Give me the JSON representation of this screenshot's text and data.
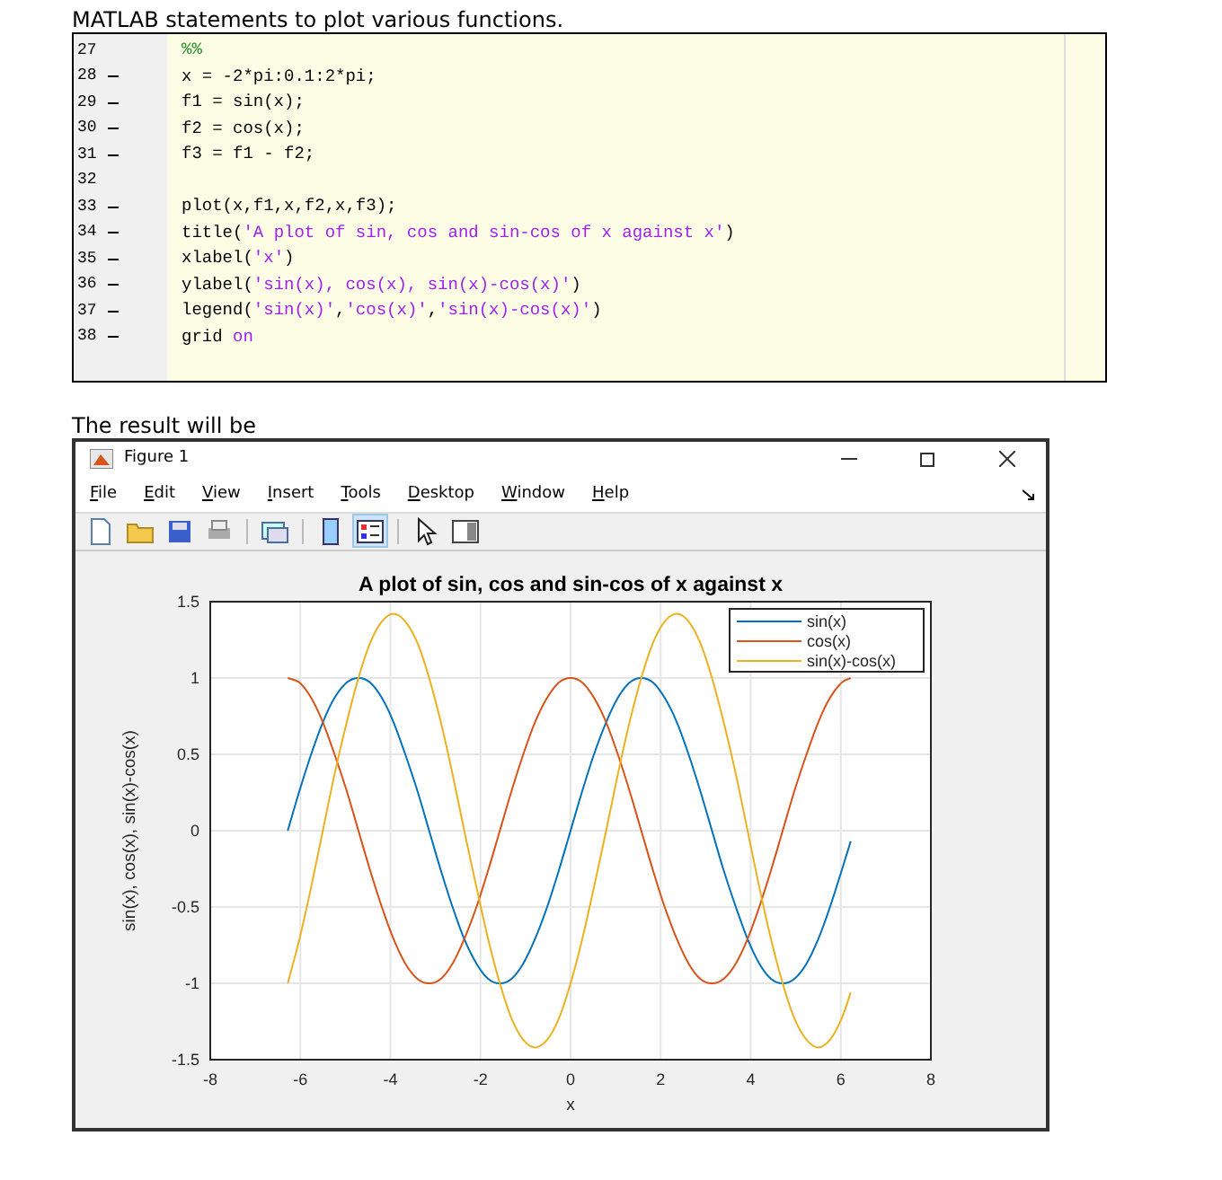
{
  "heading": "MATLAB statements to plot various functions.",
  "editor": {
    "lines": [
      {
        "number": "27",
        "executable": false,
        "tokens": [
          {
            "kind": "comment",
            "text": "%%"
          }
        ]
      },
      {
        "number": "28",
        "executable": true,
        "tokens": [
          {
            "kind": "plain",
            "text": "x = -2*pi:0.1:2*pi;"
          }
        ]
      },
      {
        "number": "29",
        "executable": true,
        "tokens": [
          {
            "kind": "plain",
            "text": "f1 = sin(x);"
          }
        ]
      },
      {
        "number": "30",
        "executable": true,
        "tokens": [
          {
            "kind": "plain",
            "text": "f2 = cos(x);"
          }
        ]
      },
      {
        "number": "31",
        "executable": true,
        "tokens": [
          {
            "kind": "plain",
            "text": "f3 = f1 - f2;"
          }
        ]
      },
      {
        "number": "32",
        "executable": false
      },
      {
        "number": "33",
        "executable": true,
        "tokens": [
          {
            "kind": "plain",
            "text": "plot(x,f1,x,f2,x,f3);"
          }
        ]
      },
      {
        "number": "34",
        "executable": true,
        "tokens": [
          {
            "kind": "plain",
            "text": "title("
          },
          {
            "kind": "string",
            "text": "'A plot of sin, cos and sin-cos of x against x'"
          },
          {
            "kind": "plain",
            "text": ")"
          }
        ]
      },
      {
        "number": "35",
        "executable": true,
        "tokens": [
          {
            "kind": "plain",
            "text": "xlabel("
          },
          {
            "kind": "string",
            "text": "'x'"
          },
          {
            "kind": "plain",
            "text": ")"
          }
        ]
      },
      {
        "number": "36",
        "executable": true,
        "tokens": [
          {
            "kind": "plain",
            "text": "ylabel("
          },
          {
            "kind": "string",
            "text": "'sin(x), cos(x), sin(x)-cos(x)'"
          },
          {
            "kind": "plain",
            "text": ")"
          }
        ]
      },
      {
        "number": "37",
        "executable": true,
        "tokens": [
          {
            "kind": "plain",
            "text": "legend("
          },
          {
            "kind": "string",
            "text": "'sin(x)'"
          },
          {
            "kind": "plain",
            "text": ","
          },
          {
            "kind": "string",
            "text": "'cos(x)'"
          },
          {
            "kind": "plain",
            "text": ","
          },
          {
            "kind": "string",
            "text": "'sin(x)-cos(x)'"
          },
          {
            "kind": "plain",
            "text": ")"
          }
        ]
      },
      {
        "number": "38",
        "executable": true,
        "tokens": [
          {
            "kind": "plain",
            "text": "grid "
          },
          {
            "kind": "string",
            "text": "on"
          }
        ]
      }
    ]
  },
  "intro": "The result will be",
  "figure": {
    "title": "Figure 1",
    "menus": [
      "File",
      "Edit",
      "View",
      "Insert",
      "Tools",
      "Desktop",
      "Window",
      "Help"
    ],
    "toolbar": [
      {
        "kind": "new",
        "selected": false
      },
      {
        "kind": "open",
        "selected": false
      },
      {
        "kind": "save",
        "selected": false
      },
      {
        "kind": "print",
        "selected": false
      },
      {
        "kind": "link",
        "selected": false
      },
      {
        "kind": "colorbar",
        "selected": false
      },
      {
        "kind": "legend",
        "selected": true
      },
      {
        "kind": "pointer",
        "selected": false
      },
      {
        "kind": "property",
        "selected": false
      }
    ],
    "chart_data": {
      "type": "line",
      "title": "A plot of sin, cos and sin-cos of x against x",
      "xlabel": "x",
      "ylabel": "sin(x), cos(x), sin(x)-cos(x)",
      "x": [
        -6.28,
        -6.02,
        -5.76,
        -5.5,
        -5.24,
        -4.97,
        -4.71,
        -4.45,
        -4.19,
        -3.93,
        -3.67,
        -3.4,
        -3.14,
        -2.88,
        -2.62,
        -2.36,
        -2.09,
        -1.83,
        -1.57,
        -1.31,
        -1.05,
        -0.79,
        -0.52,
        -0.26,
        0,
        0.26,
        0.52,
        0.79,
        1.05,
        1.31,
        1.57,
        1.83,
        2.09,
        2.36,
        2.62,
        2.88,
        3.14,
        3.4,
        3.67,
        3.93,
        4.19,
        4.45,
        4.71,
        4.97,
        5.24,
        5.5,
        5.76,
        6.02,
        6.22
      ],
      "series": [
        {
          "name": "sin(x)",
          "color": "#0072bd",
          "values": [
            0,
            0.26,
            0.5,
            0.71,
            0.87,
            0.97,
            1,
            0.97,
            0.87,
            0.71,
            0.5,
            0.26,
            0,
            -0.26,
            -0.5,
            -0.71,
            -0.87,
            -0.97,
            -1,
            -0.97,
            -0.87,
            -0.71,
            -0.5,
            -0.26,
            0,
            0.26,
            0.5,
            0.71,
            0.87,
            0.97,
            1,
            0.97,
            0.87,
            0.71,
            0.5,
            0.26,
            0,
            -0.26,
            -0.5,
            -0.71,
            -0.87,
            -0.97,
            -1,
            -0.97,
            -0.87,
            -0.71,
            -0.5,
            -0.26,
            -0.07
          ]
        },
        {
          "name": "cos(x)",
          "color": "#d95319",
          "values": [
            1,
            0.97,
            0.87,
            0.71,
            0.5,
            0.26,
            0,
            -0.26,
            -0.5,
            -0.71,
            -0.87,
            -0.97,
            -1,
            -0.97,
            -0.87,
            -0.71,
            -0.5,
            -0.26,
            0,
            0.26,
            0.5,
            0.71,
            0.87,
            0.97,
            1,
            0.97,
            0.87,
            0.71,
            0.5,
            0.26,
            0,
            -0.26,
            -0.5,
            -0.71,
            -0.87,
            -0.97,
            -1,
            -0.97,
            -0.87,
            -0.71,
            -0.5,
            -0.26,
            0,
            0.26,
            0.5,
            0.71,
            0.87,
            0.97,
            1
          ]
        },
        {
          "name": "sin(x)-cos(x)",
          "color": "#edb120",
          "values": [
            -1,
            -0.71,
            -0.37,
            0,
            0.37,
            0.71,
            1,
            1.23,
            1.37,
            1.42,
            1.37,
            1.23,
            1,
            0.71,
            0.37,
            0,
            -0.37,
            -0.71,
            -1,
            -1.23,
            -1.37,
            -1.42,
            -1.37,
            -1.23,
            -1,
            -0.71,
            -0.37,
            0,
            0.37,
            0.71,
            1,
            1.23,
            1.37,
            1.42,
            1.37,
            1.23,
            1,
            0.71,
            0.37,
            0,
            -0.37,
            -0.71,
            -1,
            -1.23,
            -1.37,
            -1.42,
            -1.37,
            -1.23,
            -1.06
          ]
        }
      ],
      "xlim": [
        -8,
        8
      ],
      "ylim": [
        -1.5,
        1.5
      ],
      "xticks": [
        -8,
        -6,
        -4,
        -2,
        0,
        2,
        4,
        6,
        8
      ],
      "yticks": [
        -1.5,
        -1,
        -0.5,
        0,
        0.5,
        1,
        1.5
      ],
      "grid": true,
      "legend": true
    }
  }
}
